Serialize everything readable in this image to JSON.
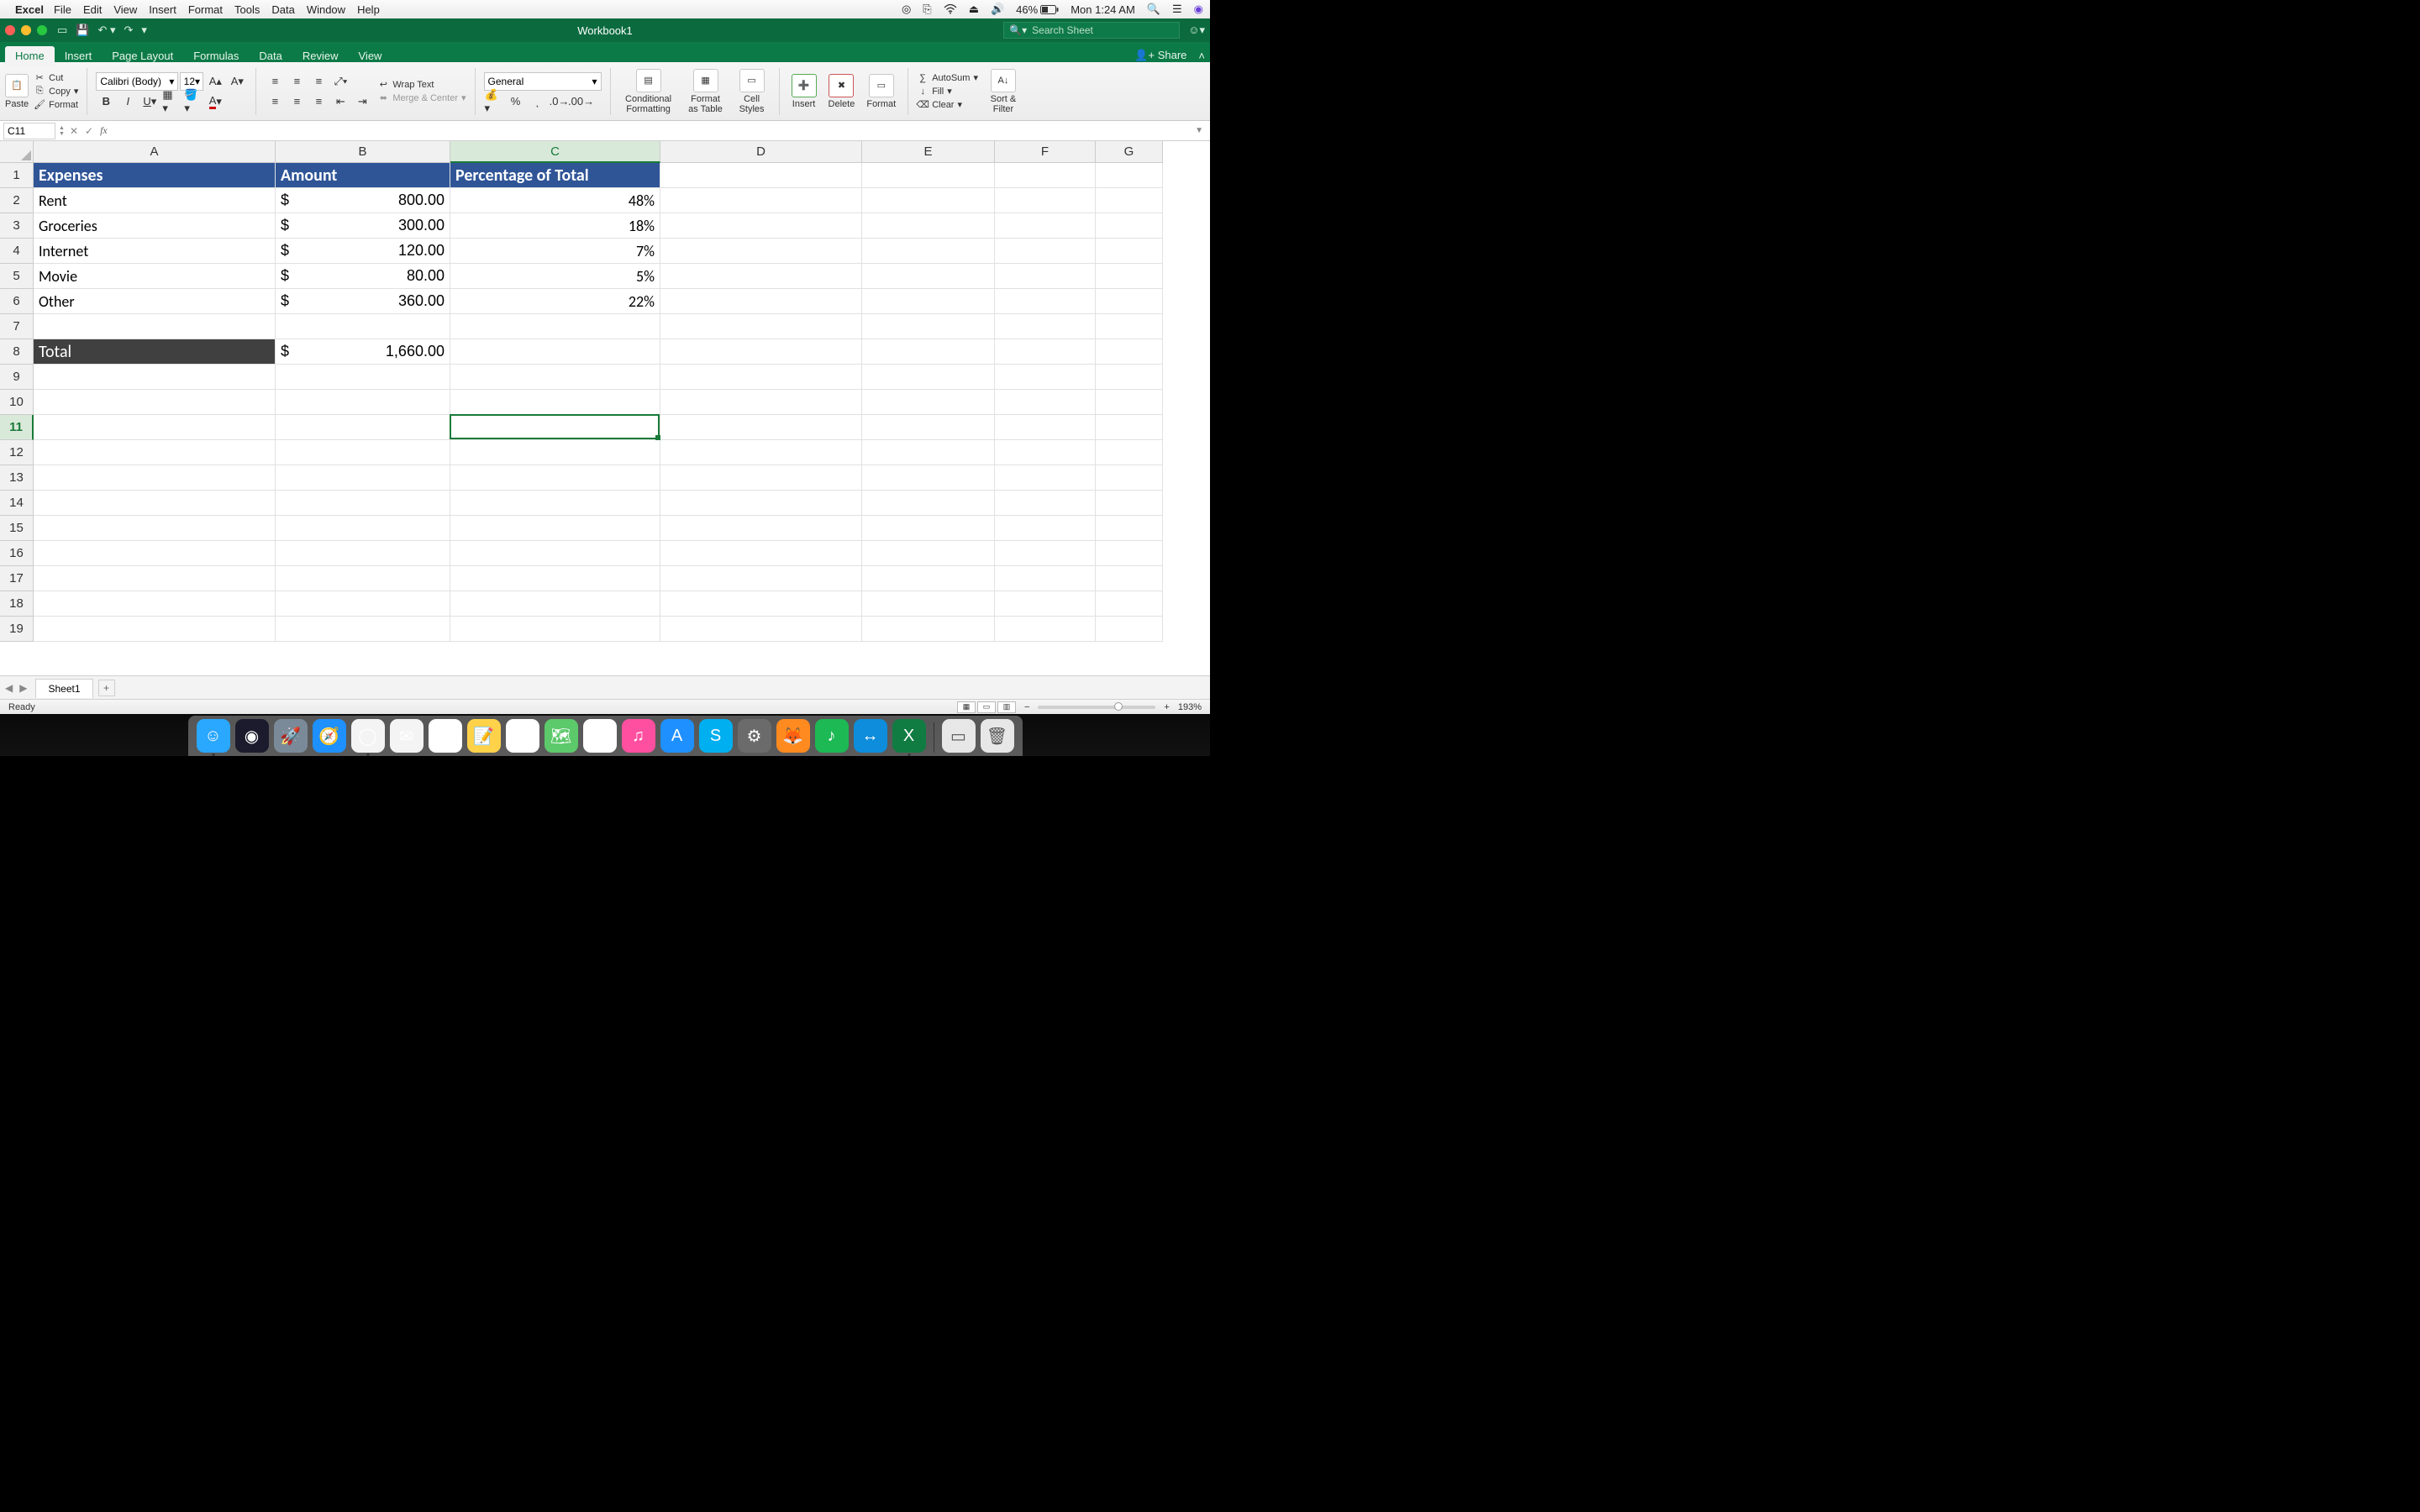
{
  "menubar": {
    "app": "Excel",
    "items": [
      "File",
      "Edit",
      "View",
      "Insert",
      "Format",
      "Tools",
      "Data",
      "Window",
      "Help"
    ],
    "battery": "46%",
    "clock": "Mon 1:24 AM"
  },
  "titlebar": {
    "workbook": "Workbook1",
    "search_placeholder": "Search Sheet"
  },
  "ribbon": {
    "tabs": [
      "Home",
      "Insert",
      "Page Layout",
      "Formulas",
      "Data",
      "Review",
      "View"
    ],
    "active_tab": "Home",
    "share": "Share",
    "clipboard": {
      "paste": "Paste",
      "cut": "Cut",
      "copy": "Copy",
      "format": "Format"
    },
    "font": {
      "name": "Calibri (Body)",
      "size": "12"
    },
    "alignment": {
      "wrap": "Wrap Text",
      "merge": "Merge & Center"
    },
    "number": {
      "format": "General"
    },
    "styles": {
      "cond": "Conditional Formatting",
      "table": "Format as Table",
      "cell": "Cell Styles"
    },
    "cells": {
      "insert": "Insert",
      "delete": "Delete",
      "format": "Format"
    },
    "editing": {
      "autosum": "AutoSum",
      "fill": "Fill",
      "clear": "Clear",
      "sort": "Sort & Filter"
    }
  },
  "formula_bar": {
    "namebox": "C11",
    "formula": ""
  },
  "columns": [
    "A",
    "B",
    "C",
    "D",
    "E",
    "F",
    "G"
  ],
  "selected_col": "C",
  "selected_row": 11,
  "rows_visible": 19,
  "data_headers": {
    "a": "Expenses",
    "b": "Amount",
    "c": "Percentage of Total"
  },
  "data_rows": [
    {
      "label": "Rent",
      "sym": "$",
      "amount": "800.00",
      "pct": "48%"
    },
    {
      "label": "Groceries",
      "sym": "$",
      "amount": "300.00",
      "pct": "18%"
    },
    {
      "label": "Internet",
      "sym": "$",
      "amount": "120.00",
      "pct": "7%"
    },
    {
      "label": "Movie",
      "sym": "$",
      "amount": "80.00",
      "pct": "5%"
    },
    {
      "label": "Other",
      "sym": "$",
      "amount": "360.00",
      "pct": "22%"
    }
  ],
  "total_row": {
    "label": "Total",
    "sym": "$",
    "amount": "1,660.00"
  },
  "sheet_tabs": {
    "active": "Sheet1"
  },
  "statusbar": {
    "ready": "Ready",
    "zoom": "193%"
  },
  "dock": [
    {
      "name": "finder",
      "bg": "#2aa7ff",
      "glyph": "☺",
      "running": true
    },
    {
      "name": "siri",
      "bg": "#1b1b2d",
      "glyph": "◉",
      "running": false
    },
    {
      "name": "launchpad",
      "bg": "#7a8a99",
      "glyph": "🚀",
      "running": false
    },
    {
      "name": "safari",
      "bg": "#1e90ff",
      "glyph": "🧭",
      "running": false
    },
    {
      "name": "chrome",
      "bg": "#f4f4f4",
      "glyph": "◯",
      "running": true
    },
    {
      "name": "mail",
      "bg": "#f4f4f4",
      "glyph": "✉",
      "running": false
    },
    {
      "name": "calendar",
      "bg": "#fff",
      "glyph": "5",
      "running": false
    },
    {
      "name": "notes",
      "bg": "#ffd24a",
      "glyph": "📝",
      "running": false
    },
    {
      "name": "reminders",
      "bg": "#fff",
      "glyph": "☑",
      "running": false
    },
    {
      "name": "maps",
      "bg": "#5cc96a",
      "glyph": "🗺",
      "running": false
    },
    {
      "name": "photos",
      "bg": "#fff",
      "glyph": "✿",
      "running": false
    },
    {
      "name": "itunes",
      "bg": "#ff4fa0",
      "glyph": "♫",
      "running": false
    },
    {
      "name": "appstore",
      "bg": "#1e90ff",
      "glyph": "A",
      "running": false
    },
    {
      "name": "skype",
      "bg": "#00aff0",
      "glyph": "S",
      "running": false
    },
    {
      "name": "settings",
      "bg": "#6b6b6b",
      "glyph": "⚙",
      "running": false
    },
    {
      "name": "firefox",
      "bg": "#ff8a1f",
      "glyph": "🦊",
      "running": false
    },
    {
      "name": "spotify",
      "bg": "#1db954",
      "glyph": "♪",
      "running": false
    },
    {
      "name": "teamviewer",
      "bg": "#0d8ddb",
      "glyph": "↔",
      "running": false
    },
    {
      "name": "excel",
      "bg": "#107c41",
      "glyph": "X",
      "running": true
    }
  ],
  "dock_right": [
    {
      "name": "ziptool",
      "bg": "#e7e7e7",
      "glyph": "▭"
    },
    {
      "name": "trash",
      "bg": "#e7e7e7",
      "glyph": "🗑"
    }
  ]
}
